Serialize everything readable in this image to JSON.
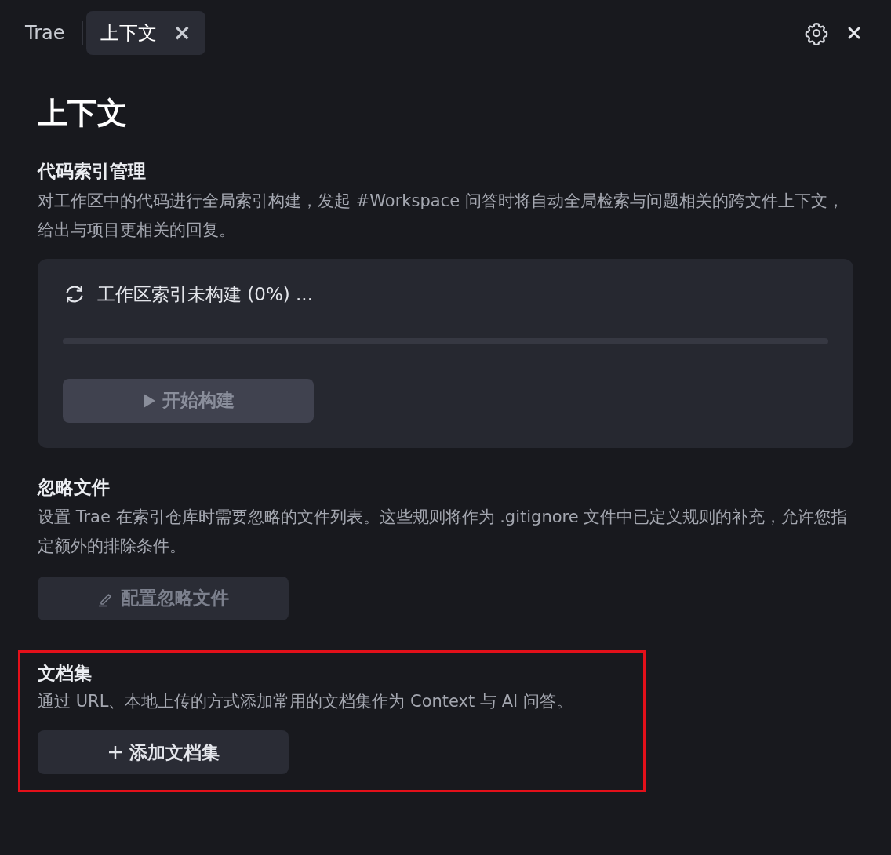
{
  "tabs": [
    {
      "label": "Trae",
      "selected": false
    },
    {
      "label": "上下文",
      "selected": true,
      "close_glyph": "×"
    }
  ],
  "title": "上下文",
  "sections": [
    {
      "heading": "代码索引管理",
      "description": "对工作区中的代码进行全局索引构建，发起 #Workspace 问答时将自动全局检索与问题相关的跨文件上下文，给出与项目更相关的回复。",
      "highlighted": false,
      "index_card": {
        "status": "工作区索引未构建 (0%) ...",
        "level": 0,
        "button": {
          "label": "开始构建",
          "kind": "play",
          "disabled": true
        }
      }
    },
    {
      "heading": "忽略文件",
      "description": "设置 Trae 在索引仓库时需要忽略的文件列表。这些规则将作为 .gitignore 文件中已定义规则的补充，允许您指定额外的排除条件。",
      "highlighted": false,
      "button": {
        "label": "配置忽略文件",
        "kind": "pencil",
        "disabled": true
      }
    },
    {
      "heading": "文档集",
      "description": "通过 URL、本地上传的方式添加常用的文档集作为 Context 与 AI 问答。",
      "highlighted": true,
      "button": {
        "label": "添加文档集",
        "kind": "plus",
        "disabled": false
      }
    }
  ]
}
